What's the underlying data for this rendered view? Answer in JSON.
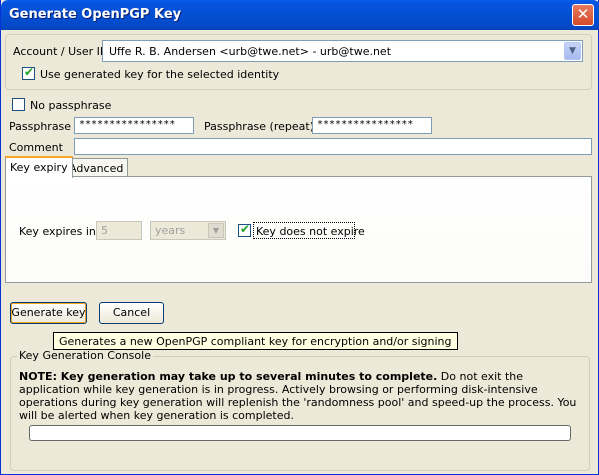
{
  "window": {
    "title": "Generate OpenPGP Key",
    "close_glyph": "✕"
  },
  "account": {
    "label": "Account / User ID",
    "selected": "Uffe R. B. Andersen <urb@twe.net> - urb@twe.net",
    "use_generated_label": "Use generated key for the selected identity",
    "use_generated_checked": true
  },
  "passphrase": {
    "no_passphrase_label": "No passphrase",
    "no_passphrase_checked": false,
    "label": "Passphrase",
    "value": "****************",
    "repeat_label": "Passphrase (repeat)",
    "repeat_value": "****************",
    "comment_label": "Comment",
    "comment_value": ""
  },
  "tabs": [
    {
      "label": "Key expiry",
      "active": true
    },
    {
      "label": "Advanced",
      "active": false
    }
  ],
  "expiry": {
    "label": "Key expires in",
    "amount": "5",
    "unit": "years",
    "does_not_expire_label": "Key does not expire",
    "does_not_expire_checked": true
  },
  "buttons": {
    "generate": "Generate key",
    "cancel": "Cancel"
  },
  "tooltip": "Generates a new OpenPGP compliant key for encryption and/or signing",
  "console": {
    "title": "Key Generation Console",
    "note_bold": "NOTE: Key generation may take up to several minutes to complete.",
    "note_rest": " Do not exit the application while key generation is in progress. Actively browsing or performing disk-intensive operations during key generation will replenish the 'randomness pool' and speed-up the process. You will be alerted when key generation is completed.",
    "progress": 0
  },
  "colors": {
    "titlebar": "#0450d4",
    "dialog_bg": "#ece9d8",
    "check": "#21a121"
  },
  "icons": {
    "close": "close-icon",
    "dropdown": "chevron-down-icon",
    "check": "checkmark-icon"
  }
}
